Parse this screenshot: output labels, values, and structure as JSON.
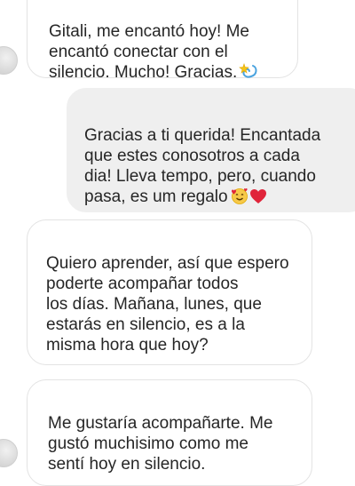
{
  "thread": {
    "messages": [
      {
        "direction": "received",
        "text": "Gitali, me encantó hoy! Me\nencantó conectar con el\nsilencio. Mucho! Gracias.",
        "trailing_emoji": "dizzy-emoji"
      },
      {
        "direction": "sent",
        "text": "Gracias a ti querida! Encantada\nque estes conosotros a cada\ndia! Lleva tempo, pero, cuando\npasa, es um regalo",
        "trailing_emoji": [
          "smiling-face-with-hearts-emoji",
          "red-heart-emoji"
        ]
      },
      {
        "direction": "received",
        "text": "Quiero aprender, así que espero\npoderte acompañar todos\nlos días. Mañana, lunes, que\nestarás en silencio, es a la\nmisma hora que hoy?"
      },
      {
        "direction": "received",
        "text": "Me gustaría acompañarte. Me\ngustó muchisimo como me\nsentí hoy en silencio."
      }
    ]
  },
  "colors": {
    "received_bubble_bg": "#ffffff",
    "received_bubble_border": "#e3e3e3",
    "sent_bubble_bg": "#efefef",
    "text": "#262626",
    "heart": "#e0243a",
    "sparkle": "#f5c518",
    "swirl": "#4aa3df"
  }
}
